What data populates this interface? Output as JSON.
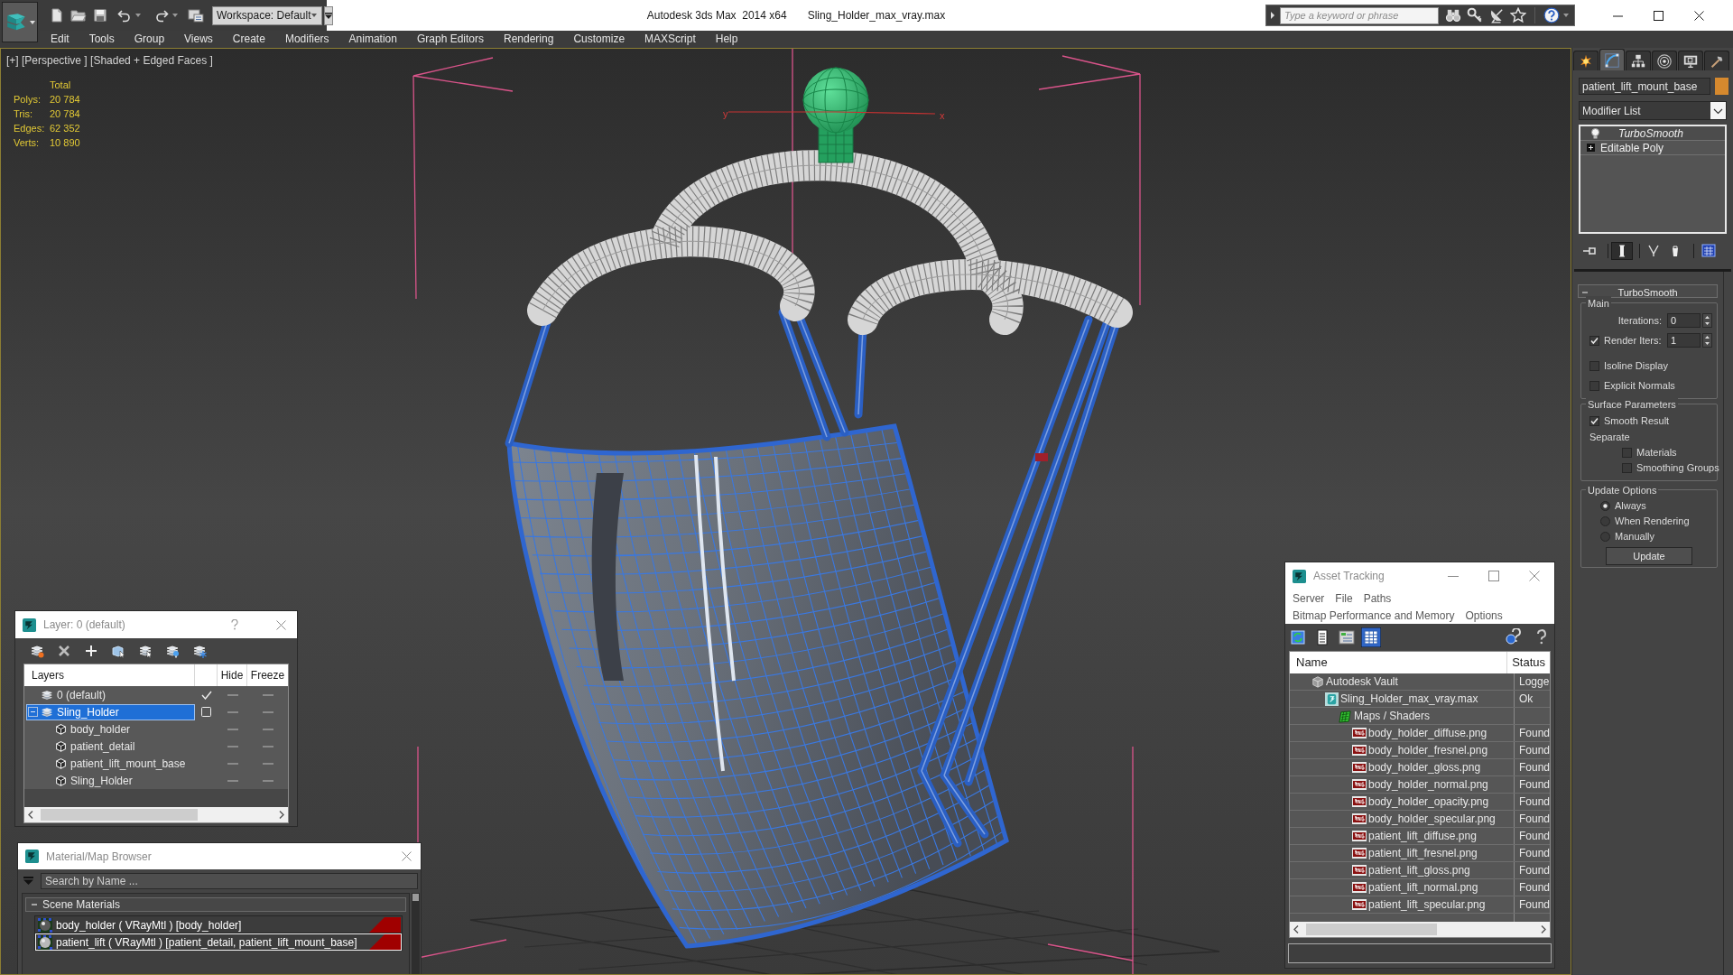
{
  "title_bar": {
    "workspace": "Workspace: Default",
    "app_title": "Autodesk 3ds Max  2014 x64",
    "file_name": "Sling_Holder_max_vray.max",
    "search": {
      "placeholder": "Type a keyword or phrase"
    }
  },
  "menu": [
    "Edit",
    "Tools",
    "Group",
    "Views",
    "Create",
    "Modifiers",
    "Animation",
    "Graph Editors",
    "Rendering",
    "Customize",
    "MAXScript",
    "Help"
  ],
  "viewport": {
    "label": "[+] [Perspective ] [Shaded + Edged Faces ]",
    "stats": {
      "heading": "Total",
      "rows": [
        {
          "label": "Polys:",
          "value": "20 784"
        },
        {
          "label": "Tris:",
          "value": "20 784"
        },
        {
          "label": "Edges:",
          "value": "62 352"
        },
        {
          "label": "Verts:",
          "value": "10 890"
        }
      ]
    },
    "gizmo_labels": [
      "y",
      "x"
    ]
  },
  "layer_dialog": {
    "title": "Layer: 0 (default)",
    "columns": {
      "name": "Layers",
      "hide": "Hide",
      "freeze": "Freeze"
    },
    "layers": [
      {
        "kind": "layer",
        "name": "0 (default)",
        "selected": false,
        "current": true,
        "hidden": false,
        "frozen": false
      },
      {
        "kind": "layer",
        "name": "Sling_Holder",
        "selected": true,
        "current": false,
        "expanded": true,
        "hidden": false,
        "frozen": false,
        "children": [
          {
            "kind": "object",
            "name": "body_holder",
            "selected": false,
            "hidden": false,
            "frozen": false
          },
          {
            "kind": "object",
            "name": "patient_detail",
            "selected": false,
            "hidden": false,
            "frozen": false
          },
          {
            "kind": "object",
            "name": "patient_lift_mount_base",
            "selected": false,
            "hidden": false,
            "frozen": false
          },
          {
            "kind": "object",
            "name": "Sling_Holder",
            "selected": false,
            "hidden": false,
            "frozen": false
          }
        ]
      }
    ]
  },
  "material_browser": {
    "title": "Material/Map Browser",
    "search": {
      "placeholder": "Search by Name ..."
    },
    "groups": [
      {
        "label": "Scene Materials",
        "expanded": true,
        "items": [
          {
            "name": "body_holder ( VRayMtl ) [body_holder]",
            "selected": false
          },
          {
            "name": "patient_lift ( VRayMtl ) [patient_detail, patient_lift_mount_base]",
            "selected": true
          }
        ]
      }
    ]
  },
  "asset_tracking": {
    "title": "Asset Tracking",
    "menu_rows": [
      [
        "Server",
        "File",
        "Paths"
      ],
      [
        "Bitmap Performance and Memory",
        "Options"
      ]
    ],
    "toolbar": [
      {
        "selected": false
      },
      {
        "selected": false
      },
      {
        "selected": false
      },
      {
        "selected": true
      }
    ],
    "columns": {
      "name": "Name",
      "status": "Status"
    },
    "assets": [
      {
        "kind": "vault",
        "name": "Autodesk Vault",
        "status": "Logge",
        "children": [
          {
            "kind": "scene",
            "name": "Sling_Holder_max_vray.max",
            "status": "Ok",
            "children": [
              {
                "kind": "folder",
                "name": "Maps / Shaders",
                "children": [
                  {
                    "kind": "image",
                    "name": "body_holder_diffuse.png",
                    "status": "Found"
                  },
                  {
                    "kind": "image",
                    "name": "body_holder_fresnel.png",
                    "status": "Found"
                  },
                  {
                    "kind": "image",
                    "name": "body_holder_gloss.png",
                    "status": "Found"
                  },
                  {
                    "kind": "image",
                    "name": "body_holder_normal.png",
                    "status": "Found"
                  },
                  {
                    "kind": "image",
                    "name": "body_holder_opacity.png",
                    "status": "Found"
                  },
                  {
                    "kind": "image",
                    "name": "body_holder_specular.png",
                    "status": "Found"
                  },
                  {
                    "kind": "image",
                    "name": "patient_lift_diffuse.png",
                    "status": "Found"
                  },
                  {
                    "kind": "image",
                    "name": "patient_lift_fresnel.png",
                    "status": "Found"
                  },
                  {
                    "kind": "image",
                    "name": "patient_lift_gloss.png",
                    "status": "Found"
                  },
                  {
                    "kind": "image",
                    "name": "patient_lift_normal.png",
                    "status": "Found"
                  },
                  {
                    "kind": "image",
                    "name": "patient_lift_specular.png",
                    "status": "Found"
                  }
                ]
              }
            ]
          }
        ]
      }
    ]
  },
  "command_panel": {
    "tabs": [
      {
        "selected": false
      },
      {
        "selected": true
      },
      {
        "selected": false
      },
      {
        "selected": false
      },
      {
        "selected": false
      },
      {
        "selected": false
      }
    ],
    "object_name": "patient_lift_mount_base",
    "modifier_list": "Modifier List",
    "stack": [
      {
        "kind": "modifier",
        "name": "TurboSmooth",
        "on": true
      },
      {
        "kind": "base",
        "name": "Editable Poly",
        "expanded": false
      }
    ],
    "stack_tools": [
      {
        "selected": false
      },
      {
        "selected": true
      },
      {
        "selected": false
      },
      {
        "selected": false
      },
      {
        "selected": false
      }
    ],
    "rollout": {
      "title": "TurboSmooth",
      "expanded": true,
      "groups": [
        {
          "title": "Main",
          "controls": [
            {
              "kind": "spinner",
              "label": "Iterations:",
              "value": "0"
            },
            {
              "kind": "check_spinner",
              "label": "Render Iters:",
              "checked": true,
              "value": "1"
            },
            {
              "kind": "checkbox",
              "label": "Isoline Display",
              "checked": false
            },
            {
              "kind": "checkbox",
              "label": "Explicit Normals",
              "checked": false
            }
          ]
        },
        {
          "title": "Surface Parameters",
          "controls": [
            {
              "kind": "checkbox",
              "label": "Smooth Result",
              "checked": true
            },
            {
              "kind": "label",
              "label": "Separate"
            },
            {
              "kind": "sub_checkbox",
              "label": "Materials",
              "checked": false
            },
            {
              "kind": "sub_checkbox",
              "label": "Smoothing Groups",
              "checked": false
            }
          ]
        },
        {
          "title": "Update Options",
          "controls": [
            {
              "kind": "radio",
              "label": "Always",
              "selected": true
            },
            {
              "kind": "radio",
              "label": "When Rendering",
              "selected": false
            },
            {
              "kind": "radio",
              "label": "Manually",
              "selected": false
            },
            {
              "kind": "button",
              "label": "Update"
            }
          ]
        }
      ]
    }
  }
}
